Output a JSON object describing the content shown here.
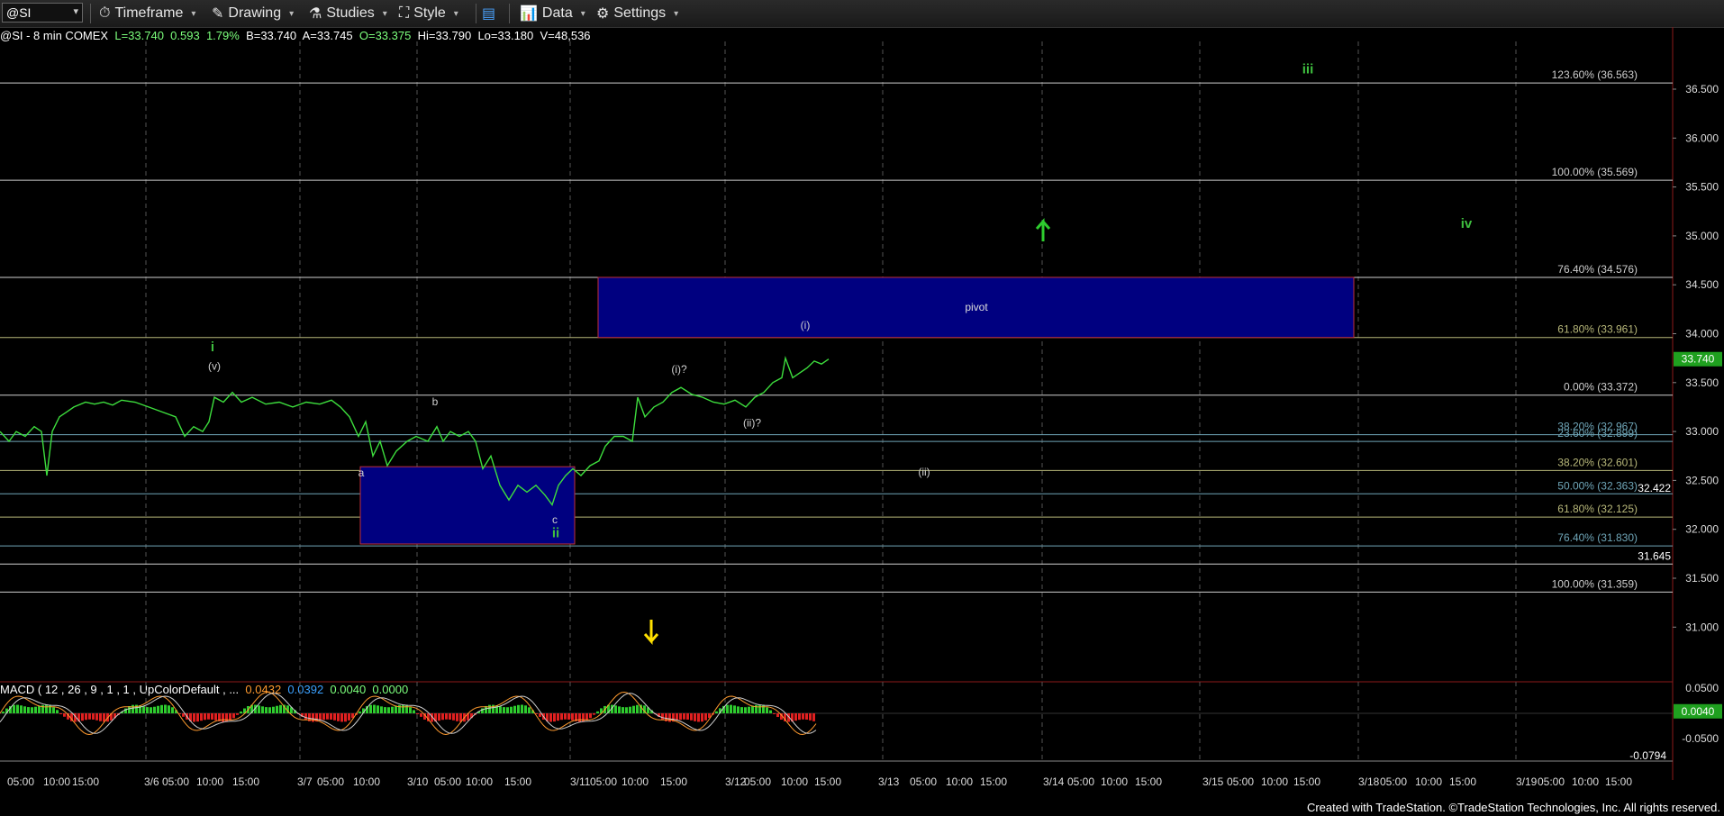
{
  "toolbar": {
    "symbol": "@SI",
    "timeframe": "Timeframe",
    "drawing": "Drawing",
    "studies": "Studies",
    "style": "Style",
    "data": "Data",
    "settings": "Settings"
  },
  "info": {
    "title": "@SI - 8 min  COMEX",
    "last": "L=33.740",
    "change": "0.593",
    "pct": "1.79%",
    "bid": "B=33.740",
    "ask": "A=33.745",
    "open": "O=33.375",
    "high": "Hi=33.790",
    "low": "Lo=33.180",
    "volume": "V=48,536"
  },
  "macd": {
    "label": "MACD ( 12 , 26 , 9 , 1 , 1 , UpColorDefault , ...",
    "v1": "0.0432",
    "v2": "0.0392",
    "v3": "0.0040",
    "v4": "0.0000",
    "axis_ticks": [
      "0.0500",
      "-0.0500"
    ],
    "current": "0.0040",
    "low_marker": "-0.0794"
  },
  "price_axis": {
    "ticks": [
      "36.500",
      "36.000",
      "35.500",
      "35.000",
      "34.500",
      "34.000",
      "33.500",
      "33.000",
      "32.500",
      "32.000",
      "31.500",
      "31.000"
    ],
    "last_price": "33.740",
    "tag_32422": "32.422",
    "tag_31645": "31.645"
  },
  "time_axis": {
    "labels": [
      "05:00",
      "10:00",
      "15:00",
      "3/6",
      "05:00",
      "10:00",
      "15:00",
      "3/7",
      "05:00",
      "10:00",
      "3/10",
      "05:00",
      "10:00",
      "15:00",
      "3/11",
      "05:00",
      "10:00",
      "15:00",
      "3/12",
      "05:00",
      "10:00",
      "15:00",
      "3/13",
      "05:00",
      "10:00",
      "15:00",
      "3/14",
      "05:00",
      "10:00",
      "15:00",
      "3/15",
      "05:00",
      "10:00",
      "15:00",
      "3/18",
      "05:00",
      "10:00",
      "15:00",
      "3/19",
      "05:00",
      "10:00",
      "15:00"
    ]
  },
  "fib_levels": [
    {
      "label": "123.60% (36.563)",
      "price": 36.563,
      "color": "#cfcfcf"
    },
    {
      "label": "100.00% (35.569)",
      "price": 35.569,
      "color": "#cfcfcf"
    },
    {
      "label": "76.40% (34.576)",
      "price": 34.576,
      "color": "#cfcfcf"
    },
    {
      "label": "61.80% (33.961)",
      "price": 33.961,
      "color": "#b8b87a"
    },
    {
      "label": "0.00% (33.372)",
      "price": 33.372,
      "color": "#cfcfcf"
    },
    {
      "label": "38.20% (32.967)",
      "price": 32.967,
      "color": "#6fa6b8"
    },
    {
      "label": "23.60% (32.899)",
      "price": 32.899,
      "color": "#6fa6b8"
    },
    {
      "label": "38.20% (32.601)",
      "price": 32.601,
      "color": "#b8b87a"
    },
    {
      "label": "50.00% (32.363)",
      "price": 32.363,
      "color": "#6fa6b8"
    },
    {
      "label": "61.80% (32.125)",
      "price": 32.125,
      "color": "#b8b87a"
    },
    {
      "label": "76.40% (31.830)",
      "price": 31.83,
      "color": "#6fa6b8"
    },
    {
      "label": "100.00% (31.359)",
      "price": 31.359,
      "color": "#cfcfcf"
    }
  ],
  "wave_labels": [
    {
      "text": "iii",
      "color": "#3fbf3f"
    },
    {
      "text": "iv",
      "color": "#3fbf3f"
    },
    {
      "text": "i",
      "color": "#3fbf3f"
    },
    {
      "text": "ii",
      "color": "#3fbf3f"
    },
    {
      "text": "(v)",
      "color": "#cfcfcf"
    },
    {
      "text": "b",
      "color": "#cfcfcf"
    },
    {
      "text": "a",
      "color": "#cfcfcf"
    },
    {
      "text": "c",
      "color": "#cfcfcf"
    },
    {
      "text": "(i)?",
      "color": "#cfcfcf"
    },
    {
      "text": "(ii)?",
      "color": "#cfcfcf"
    },
    {
      "text": "(i)",
      "color": "#cfcfcf"
    },
    {
      "text": "(ii)",
      "color": "#cfcfcf"
    }
  ],
  "pivot_label": "pivot",
  "footer": "Created with TradeStation. ©TradeStation Technologies, Inc. All rights reserved.",
  "colors": {
    "price": "#3dde3d",
    "pivot_box": "#000080",
    "box_border": "#c0303a",
    "up_arrow": "#2ecc2e",
    "down_arrow": "#ffe000"
  }
}
